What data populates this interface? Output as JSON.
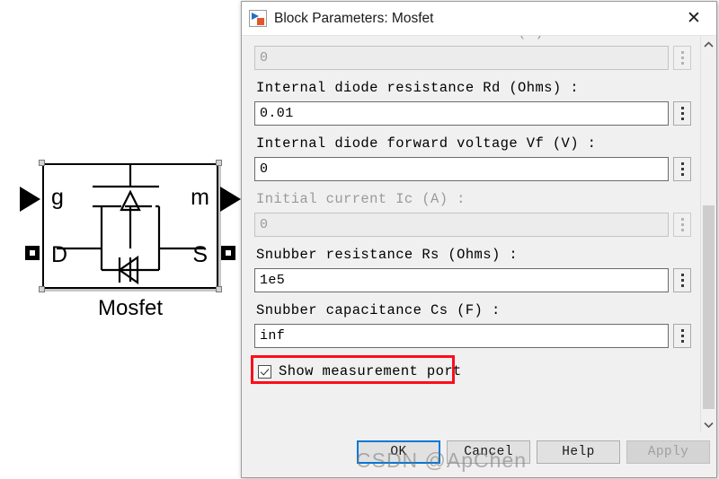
{
  "canvas": {
    "block": {
      "caption": "Mosfet",
      "port_labels": {
        "gate": "g",
        "meas": "m",
        "drain": "D",
        "source": "S"
      }
    }
  },
  "dialog": {
    "title": "Block Parameters: Mosfet",
    "icon": "simulink-block-icon",
    "close_label": "✕",
    "parameters": [
      {
        "label": "Internal diode inductance Lon (H) :",
        "value": "0",
        "disabled": true,
        "clipped": true
      },
      {
        "label": "Internal diode resistance Rd  (Ohms) :",
        "value": "0.01",
        "disabled": false
      },
      {
        "label": "Internal diode forward voltage Vf (V) :",
        "value": "0",
        "disabled": false
      },
      {
        "label": "Initial current Ic (A) :",
        "value": "0",
        "disabled": true
      },
      {
        "label": "Snubber resistance Rs (Ohms) :",
        "value": "1e5",
        "disabled": false
      },
      {
        "label": "Snubber capacitance Cs (F) :",
        "value": "inf",
        "disabled": false
      }
    ],
    "checkbox": {
      "label": "Show measurement port",
      "checked": true,
      "highlight_color": "#fc0d1b"
    },
    "scrollbar": {
      "up_arrow": "⌃",
      "down_arrow": "⌄",
      "thumb_top_percent": 42,
      "thumb_height_percent": 56
    },
    "buttons": [
      {
        "label": "OK",
        "state": "default-focused"
      },
      {
        "label": "Cancel",
        "state": "normal"
      },
      {
        "label": "Help",
        "state": "normal"
      },
      {
        "label": "Apply",
        "state": "disabled"
      }
    ],
    "accent_color": "#0078d7"
  },
  "watermark": {
    "text": "CSDN @ApChen"
  }
}
